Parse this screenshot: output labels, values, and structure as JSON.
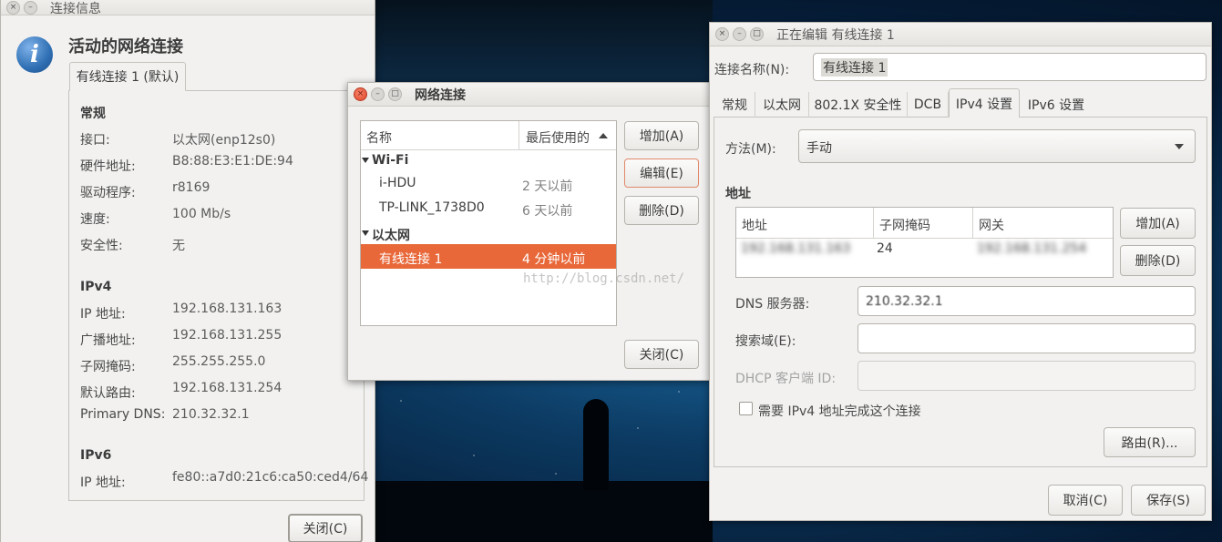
{
  "conn_info": {
    "title": "连接信息",
    "heading": "活动的网络连接",
    "tab": "有线连接 1 (默认)",
    "section_general": "常规",
    "rows_general": [
      {
        "label": "接口:",
        "value": "以太网(enp12s0)"
      },
      {
        "label": "硬件地址:",
        "value": "B8:88:E3:E1:DE:94"
      },
      {
        "label": "驱动程序:",
        "value": "r8169"
      },
      {
        "label": "速度:",
        "value": "100 Mb/s"
      },
      {
        "label": "安全性:",
        "value": "无"
      }
    ],
    "section_ipv4": "IPv4",
    "rows_ipv4": [
      {
        "label": "IP 地址:",
        "value": "192.168.131.163"
      },
      {
        "label": "广播地址:",
        "value": "192.168.131.255"
      },
      {
        "label": "子网掩码:",
        "value": "255.255.255.0"
      },
      {
        "label": "默认路由:",
        "value": "192.168.131.254"
      },
      {
        "label": "Primary DNS:",
        "value": "210.32.32.1"
      }
    ],
    "section_ipv6": "IPv6",
    "rows_ipv6": [
      {
        "label": "IP 地址:",
        "value": "fe80::a7d0:21c6:ca50:ced4/64"
      }
    ],
    "close_button": "关闭(C)"
  },
  "net_conn": {
    "title": "网络连接",
    "col_name": "名称",
    "col_last_used": "最后使用的",
    "group_wifi": "Wi-Fi",
    "wifi_items": [
      {
        "name": "i-HDU",
        "last": "2 天以前"
      },
      {
        "name": "TP-LINK_1738D0",
        "last": "6 天以前"
      }
    ],
    "group_ethernet": "以太网",
    "ethernet_items": [
      {
        "name": "有线连接 1",
        "last": "4 分钟以前"
      }
    ],
    "add_button": "增加(A)",
    "edit_button": "编辑(E)",
    "delete_button": "删除(D)",
    "close_button": "关闭(C)",
    "watermark": "http://blog.csdn.net/"
  },
  "editor": {
    "title": "正在编辑 有线连接 1",
    "conn_name_label": "连接名称(N):",
    "conn_name_value": "有线连接 1",
    "tabs": [
      "常规",
      "以太网",
      "802.1X 安全性",
      "DCB",
      "IPv4 设置",
      "IPv6 设置"
    ],
    "method_label": "方法(M):",
    "method_value": "手动",
    "address_section": "地址",
    "addr_headers": [
      "地址",
      "子网掩码",
      "网关"
    ],
    "addr_row": {
      "address": "192.168.131.163",
      "netmask": "24",
      "gateway": "192.168.131.254"
    },
    "addr_add_button": "增加(A)",
    "addr_delete_button": "删除(D)",
    "dns_label": "DNS 服务器:",
    "dns_value": "210.32.32.1",
    "search_label": "搜索域(E):",
    "search_value": "",
    "dhcp_label": "DHCP 客户端 ID:",
    "dhcp_value": "",
    "require_ipv4_checkbox": "需要 IPv4 地址完成这个连接",
    "routes_button": "路由(R)...",
    "cancel_button": "取消(C)",
    "save_button": "保存(S)"
  },
  "colors": {
    "selection": "#e8683a",
    "info_icon": "#2f6fb3"
  }
}
